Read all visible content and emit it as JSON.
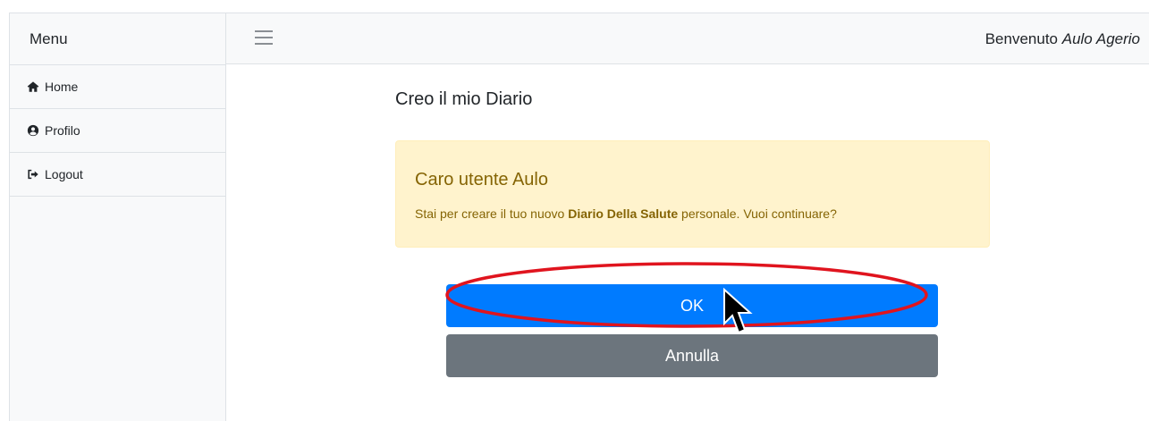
{
  "sidebar": {
    "heading": "Menu",
    "items": [
      {
        "label": "Home",
        "icon": "home-icon"
      },
      {
        "label": "Profilo",
        "icon": "user-circle-icon"
      },
      {
        "label": "Logout",
        "icon": "sign-out-icon"
      }
    ]
  },
  "topnav": {
    "welcome_prefix": "Benvenuto",
    "user_name": "Aulo Agerio"
  },
  "main": {
    "title": "Creo il mio Diario",
    "alert": {
      "heading": "Caro utente Aulo",
      "text_before": "Stai per creare il tuo nuovo ",
      "text_bold": "Diario Della Salute",
      "text_after": " personale. Vuoi continuare?"
    },
    "ok_label": "OK",
    "cancel_label": "Annulla"
  },
  "colors": {
    "primary": "#007bff",
    "secondary": "#6c757d",
    "warning_bg": "#fff3cd",
    "warning_text": "#856404",
    "annotation": "#e0141e"
  }
}
